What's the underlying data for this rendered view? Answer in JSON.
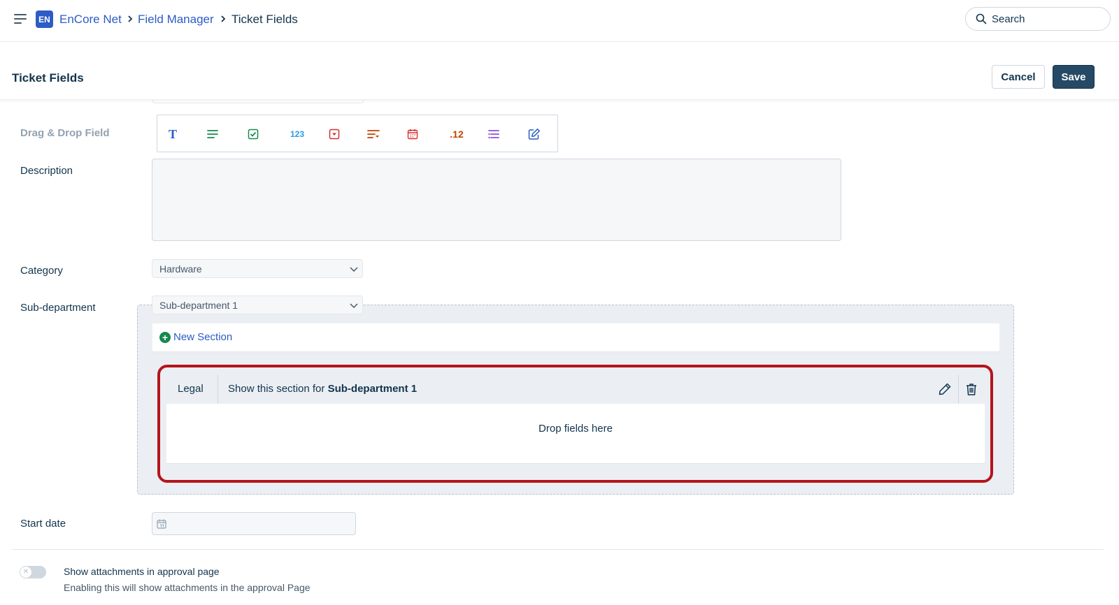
{
  "app": {
    "badge": "EN",
    "breadcrumb": [
      "EnCore Net",
      "Field Manager",
      "Ticket Fields"
    ]
  },
  "search": {
    "placeholder": "Search",
    "icon": "search-icon"
  },
  "page": {
    "title": "Ticket Fields",
    "cancel_label": "Cancel",
    "save_label": "Save"
  },
  "form": {
    "drag_drop_label": "Drag & Drop Field",
    "field_types": [
      {
        "name": "text",
        "icon": "text-field-icon",
        "glyph": "T",
        "color": "#2c5cc5"
      },
      {
        "name": "paragraph",
        "icon": "paragraph-field-icon",
        "color": "#16894f"
      },
      {
        "name": "checkbox",
        "icon": "checkbox-field-icon",
        "color": "#16894f"
      },
      {
        "name": "number",
        "icon": "number-field-icon",
        "glyph": "123",
        "color": "#2c9ae5"
      },
      {
        "name": "dropdown",
        "icon": "dropdown-field-icon",
        "color": "#d72d30"
      },
      {
        "name": "dependent",
        "icon": "dependent-field-icon",
        "color": "#c24100"
      },
      {
        "name": "date",
        "icon": "date-field-icon",
        "color": "#d72d30"
      },
      {
        "name": "decimal",
        "icon": "decimal-field-icon",
        "glyph": ".12",
        "color": "#c24100"
      },
      {
        "name": "multi-select",
        "icon": "multiselect-field-icon",
        "color": "#8c50e0"
      },
      {
        "name": "edit",
        "icon": "edit-field-icon",
        "color": "#2c5cc5"
      }
    ],
    "description_label": "Description",
    "category_label": "Category",
    "category_value": "Hardware",
    "subdept_label": "Sub-department",
    "subdept_value": "Sub-department 1",
    "new_section_label": "New Section",
    "section": {
      "name": "Legal",
      "rule_prefix": "Show this section for ",
      "rule_value": "Sub-department 1",
      "drop_text": "Drop fields here"
    },
    "start_date_label": "Start date",
    "attachments_toggle_label": "Show attachments in approval page",
    "attachments_toggle_help": "Enabling this will show attachments in the approval Page"
  },
  "colors": {
    "accent": "#2c5cc5",
    "primary_button": "#264966",
    "highlight": "#b5141c"
  }
}
